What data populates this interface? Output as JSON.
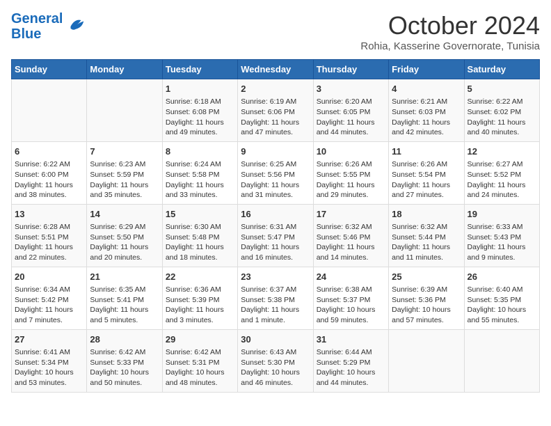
{
  "header": {
    "logo_line1": "General",
    "logo_line2": "Blue",
    "month": "October 2024",
    "location": "Rohia, Kasserine Governorate, Tunisia"
  },
  "days_of_week": [
    "Sunday",
    "Monday",
    "Tuesday",
    "Wednesday",
    "Thursday",
    "Friday",
    "Saturday"
  ],
  "weeks": [
    [
      {
        "day": "",
        "info": ""
      },
      {
        "day": "",
        "info": ""
      },
      {
        "day": "1",
        "info": "Sunrise: 6:18 AM\nSunset: 6:08 PM\nDaylight: 11 hours and 49 minutes."
      },
      {
        "day": "2",
        "info": "Sunrise: 6:19 AM\nSunset: 6:06 PM\nDaylight: 11 hours and 47 minutes."
      },
      {
        "day": "3",
        "info": "Sunrise: 6:20 AM\nSunset: 6:05 PM\nDaylight: 11 hours and 44 minutes."
      },
      {
        "day": "4",
        "info": "Sunrise: 6:21 AM\nSunset: 6:03 PM\nDaylight: 11 hours and 42 minutes."
      },
      {
        "day": "5",
        "info": "Sunrise: 6:22 AM\nSunset: 6:02 PM\nDaylight: 11 hours and 40 minutes."
      }
    ],
    [
      {
        "day": "6",
        "info": "Sunrise: 6:22 AM\nSunset: 6:00 PM\nDaylight: 11 hours and 38 minutes."
      },
      {
        "day": "7",
        "info": "Sunrise: 6:23 AM\nSunset: 5:59 PM\nDaylight: 11 hours and 35 minutes."
      },
      {
        "day": "8",
        "info": "Sunrise: 6:24 AM\nSunset: 5:58 PM\nDaylight: 11 hours and 33 minutes."
      },
      {
        "day": "9",
        "info": "Sunrise: 6:25 AM\nSunset: 5:56 PM\nDaylight: 11 hours and 31 minutes."
      },
      {
        "day": "10",
        "info": "Sunrise: 6:26 AM\nSunset: 5:55 PM\nDaylight: 11 hours and 29 minutes."
      },
      {
        "day": "11",
        "info": "Sunrise: 6:26 AM\nSunset: 5:54 PM\nDaylight: 11 hours and 27 minutes."
      },
      {
        "day": "12",
        "info": "Sunrise: 6:27 AM\nSunset: 5:52 PM\nDaylight: 11 hours and 24 minutes."
      }
    ],
    [
      {
        "day": "13",
        "info": "Sunrise: 6:28 AM\nSunset: 5:51 PM\nDaylight: 11 hours and 22 minutes."
      },
      {
        "day": "14",
        "info": "Sunrise: 6:29 AM\nSunset: 5:50 PM\nDaylight: 11 hours and 20 minutes."
      },
      {
        "day": "15",
        "info": "Sunrise: 6:30 AM\nSunset: 5:48 PM\nDaylight: 11 hours and 18 minutes."
      },
      {
        "day": "16",
        "info": "Sunrise: 6:31 AM\nSunset: 5:47 PM\nDaylight: 11 hours and 16 minutes."
      },
      {
        "day": "17",
        "info": "Sunrise: 6:32 AM\nSunset: 5:46 PM\nDaylight: 11 hours and 14 minutes."
      },
      {
        "day": "18",
        "info": "Sunrise: 6:32 AM\nSunset: 5:44 PM\nDaylight: 11 hours and 11 minutes."
      },
      {
        "day": "19",
        "info": "Sunrise: 6:33 AM\nSunset: 5:43 PM\nDaylight: 11 hours and 9 minutes."
      }
    ],
    [
      {
        "day": "20",
        "info": "Sunrise: 6:34 AM\nSunset: 5:42 PM\nDaylight: 11 hours and 7 minutes."
      },
      {
        "day": "21",
        "info": "Sunrise: 6:35 AM\nSunset: 5:41 PM\nDaylight: 11 hours and 5 minutes."
      },
      {
        "day": "22",
        "info": "Sunrise: 6:36 AM\nSunset: 5:39 PM\nDaylight: 11 hours and 3 minutes."
      },
      {
        "day": "23",
        "info": "Sunrise: 6:37 AM\nSunset: 5:38 PM\nDaylight: 11 hours and 1 minute."
      },
      {
        "day": "24",
        "info": "Sunrise: 6:38 AM\nSunset: 5:37 PM\nDaylight: 10 hours and 59 minutes."
      },
      {
        "day": "25",
        "info": "Sunrise: 6:39 AM\nSunset: 5:36 PM\nDaylight: 10 hours and 57 minutes."
      },
      {
        "day": "26",
        "info": "Sunrise: 6:40 AM\nSunset: 5:35 PM\nDaylight: 10 hours and 55 minutes."
      }
    ],
    [
      {
        "day": "27",
        "info": "Sunrise: 6:41 AM\nSunset: 5:34 PM\nDaylight: 10 hours and 53 minutes."
      },
      {
        "day": "28",
        "info": "Sunrise: 6:42 AM\nSunset: 5:33 PM\nDaylight: 10 hours and 50 minutes."
      },
      {
        "day": "29",
        "info": "Sunrise: 6:42 AM\nSunset: 5:31 PM\nDaylight: 10 hours and 48 minutes."
      },
      {
        "day": "30",
        "info": "Sunrise: 6:43 AM\nSunset: 5:30 PM\nDaylight: 10 hours and 46 minutes."
      },
      {
        "day": "31",
        "info": "Sunrise: 6:44 AM\nSunset: 5:29 PM\nDaylight: 10 hours and 44 minutes."
      },
      {
        "day": "",
        "info": ""
      },
      {
        "day": "",
        "info": ""
      }
    ]
  ]
}
